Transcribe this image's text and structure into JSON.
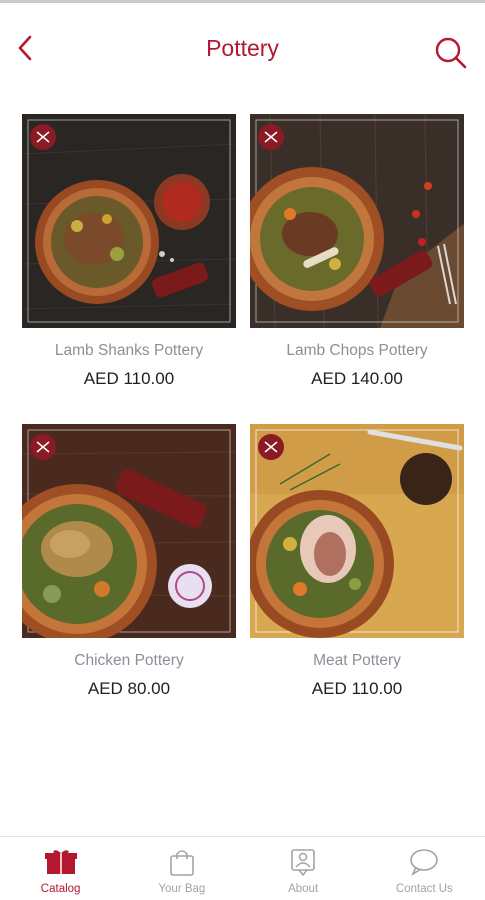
{
  "header": {
    "title": "Pottery"
  },
  "colors": {
    "accent": "#b3182e",
    "muted": "#a3a3a3"
  },
  "products": [
    {
      "name": "Lamb Shanks Pottery",
      "price": "AED 110.00"
    },
    {
      "name": "Lamb Chops Pottery",
      "price": "AED 140.00"
    },
    {
      "name": "Chicken Pottery",
      "price": "AED 80.00"
    },
    {
      "name": "Meat Pottery",
      "price": "AED 110.00"
    }
  ],
  "tabs": [
    {
      "label": "Catalog",
      "icon": "catalog-icon",
      "active": true
    },
    {
      "label": "Your Bag",
      "icon": "bag-icon",
      "active": false
    },
    {
      "label": "About",
      "icon": "about-icon",
      "active": false
    },
    {
      "label": "Contact Us",
      "icon": "chat-icon",
      "active": false
    }
  ]
}
